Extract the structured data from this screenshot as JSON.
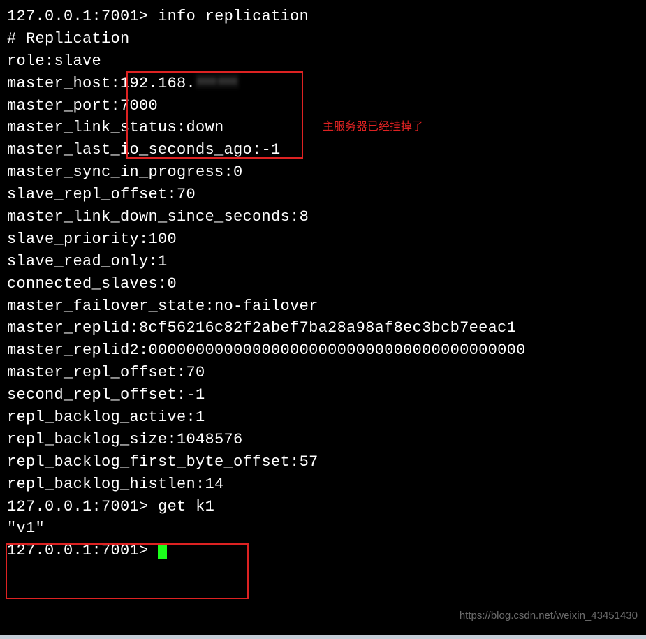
{
  "terminal": {
    "prompt": "127.0.0.1:7001>",
    "cmd_info": "info replication",
    "header": "# Replication",
    "role": "role:slave",
    "master_host_prefix": "master_host:192.168.",
    "master_port": "master_port:7000",
    "master_link_status": "master_link_status:down",
    "master_last_io": "master_last_io_seconds_ago:-1",
    "master_sync": "master_sync_in_progress:0",
    "slave_repl_offset": "slave_repl_offset:70",
    "master_link_down_since": "master_link_down_since_seconds:8",
    "slave_priority": "slave_priority:100",
    "slave_read_only": "slave_read_only:1",
    "connected_slaves": "connected_slaves:0",
    "master_failover_state": "master_failover_state:no-failover",
    "master_replid": "master_replid:8cf56216c82f2abef7ba28a98af8ec3bcb7eeac1",
    "master_replid2": "master_replid2:0000000000000000000000000000000000000000",
    "master_repl_offset": "master_repl_offset:70",
    "second_repl_offset": "second_repl_offset:-1",
    "repl_backlog_active": "repl_backlog_active:1",
    "repl_backlog_size": "repl_backlog_size:1048576",
    "repl_backlog_first_byte_offset": "repl_backlog_first_byte_offset:57",
    "repl_backlog_histlen": "repl_backlog_histlen:14",
    "cmd_get": "get k1",
    "get_result": "\"v1\""
  },
  "annotation": "主服务器已经挂掉了",
  "watermark": "https://blog.csdn.net/weixin_43451430"
}
